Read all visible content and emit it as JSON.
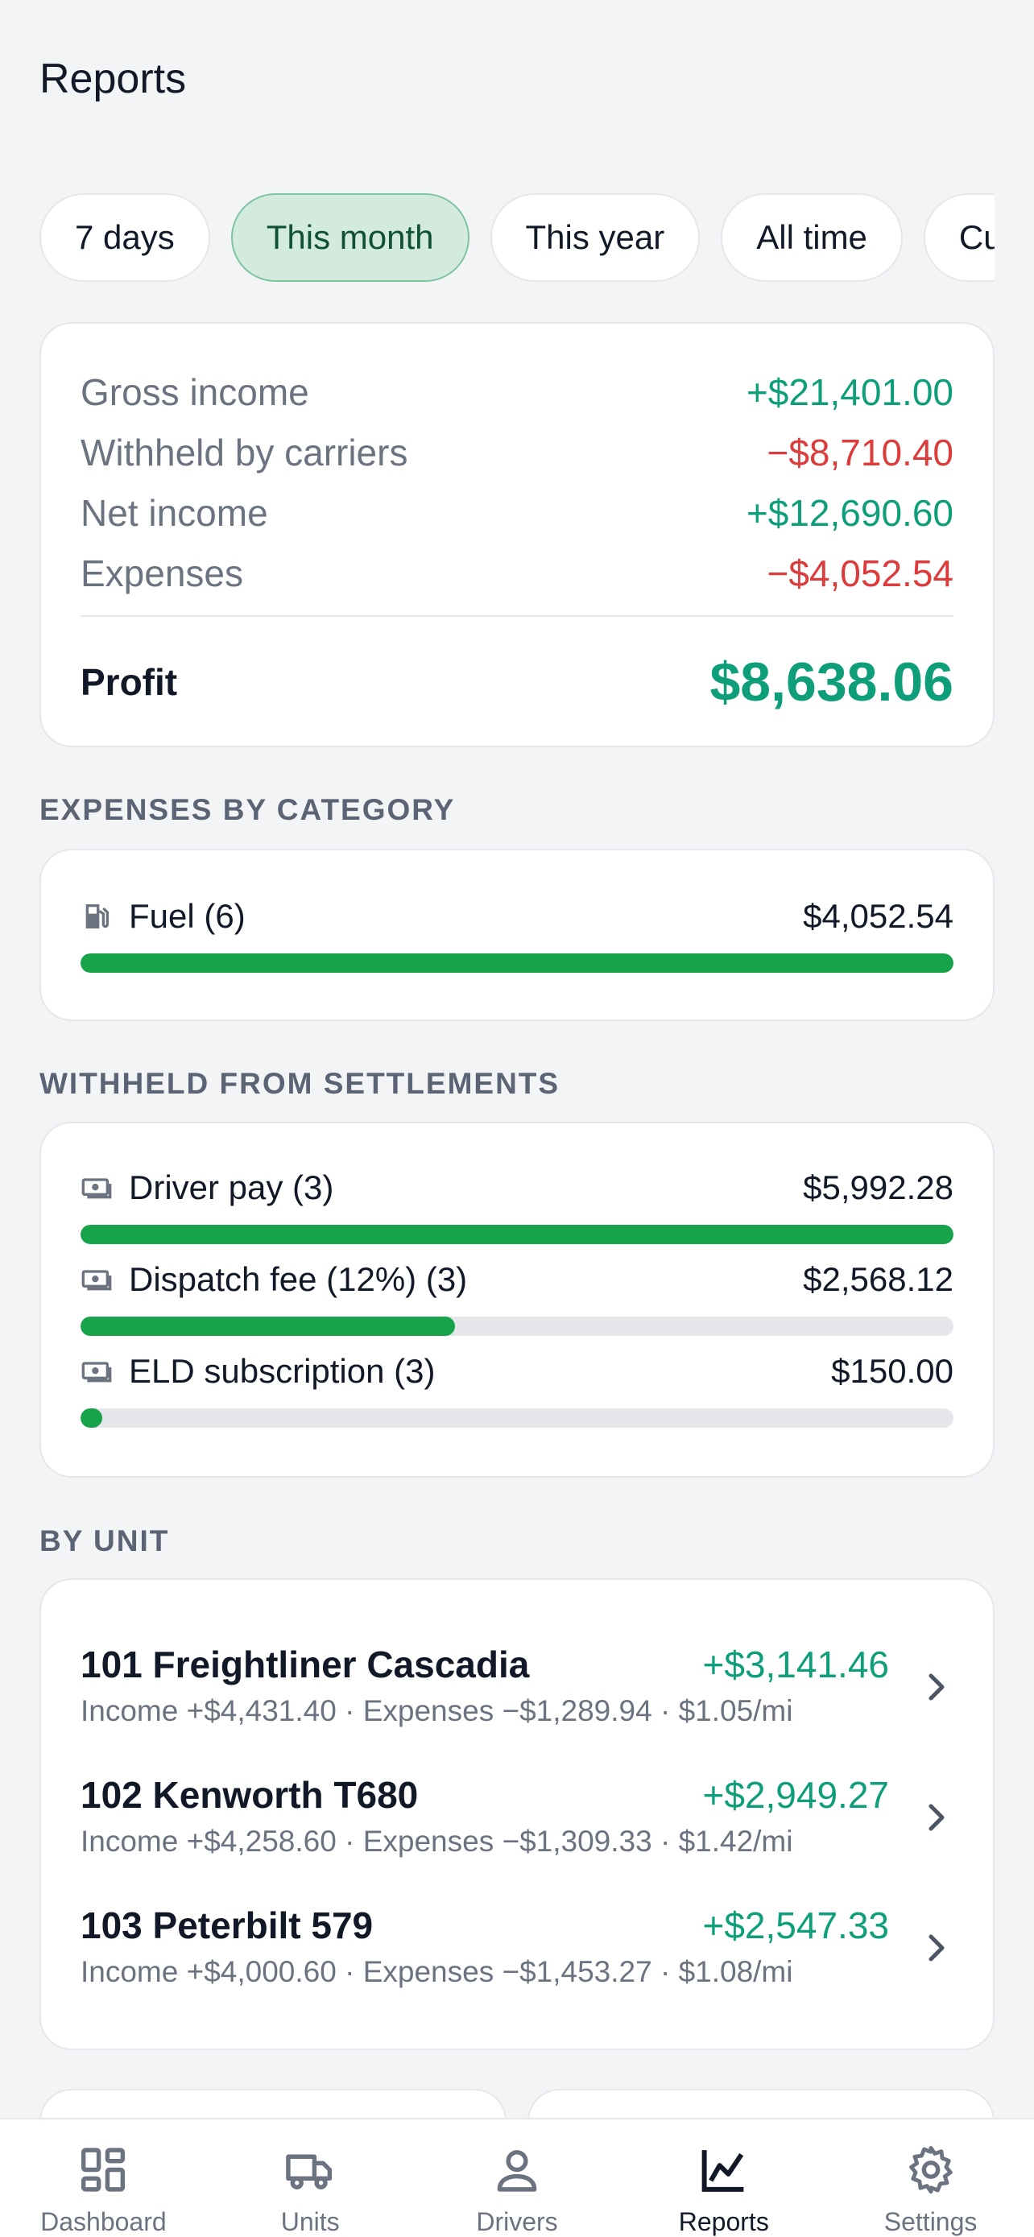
{
  "header": {
    "title": "Reports"
  },
  "periods": [
    {
      "label": "7 days",
      "active": false
    },
    {
      "label": "This month",
      "active": true
    },
    {
      "label": "This year",
      "active": false
    },
    {
      "label": "All time",
      "active": false
    },
    {
      "label": "Custom",
      "active": false
    }
  ],
  "summary": {
    "gross_label": "Gross income",
    "gross_value": "+$21,401.00",
    "withheld_label": "Withheld by carriers",
    "withheld_value": "−$8,710.40",
    "net_label": "Net income",
    "net_value": "+$12,690.60",
    "expenses_label": "Expenses",
    "expenses_value": "−$4,052.54",
    "profit_label": "Profit",
    "profit_value": "$8,638.06"
  },
  "expenses_by_category": {
    "title": "EXPENSES BY CATEGORY",
    "items": [
      {
        "label": "Fuel (6)",
        "amount": "$4,052.54",
        "fraction": 1.0,
        "icon": "fuel-icon"
      }
    ]
  },
  "withheld_from_settlements": {
    "title": "WITHHELD FROM SETTLEMENTS",
    "items": [
      {
        "label": "Driver pay (3)",
        "amount": "$5,992.28",
        "fraction": 1.0,
        "icon": "cash-icon"
      },
      {
        "label": "Dispatch fee (12%) (3)",
        "amount": "$2,568.12",
        "fraction": 0.4286,
        "icon": "cash-icon"
      },
      {
        "label": "ELD subscription (3)",
        "amount": "$150.00",
        "fraction": 0.025,
        "icon": "cash-icon"
      }
    ]
  },
  "by_unit": {
    "title": "BY UNIT",
    "items": [
      {
        "name": "101 Freightliner Cascadia",
        "profit": "+$3,141.46",
        "details": "Income +$4,431.40 · Expenses −$1,289.94 · $1.05/mi"
      },
      {
        "name": "102 Kenworth T680",
        "profit": "+$2,949.27",
        "details": "Income +$4,258.60 · Expenses −$1,309.33 · $1.42/mi"
      },
      {
        "name": "103 Peterbilt 579",
        "profit": "+$2,547.33",
        "details": "Income +$4,000.60 · Expenses −$1,453.27 · $1.08/mi"
      }
    ]
  },
  "nav": [
    {
      "label": "Dashboard",
      "icon": "dashboard-icon",
      "active": false
    },
    {
      "label": "Units",
      "icon": "truck-icon",
      "active": false
    },
    {
      "label": "Drivers",
      "icon": "person-icon",
      "active": false
    },
    {
      "label": "Reports",
      "icon": "chart-icon",
      "active": true
    },
    {
      "label": "Settings",
      "icon": "gear-icon",
      "active": false
    }
  ],
  "colors": {
    "accent": "#0e9f7a",
    "negative": "#dc3c3c",
    "bar": "#16a34a",
    "active_chip": "#d3ebdf"
  }
}
